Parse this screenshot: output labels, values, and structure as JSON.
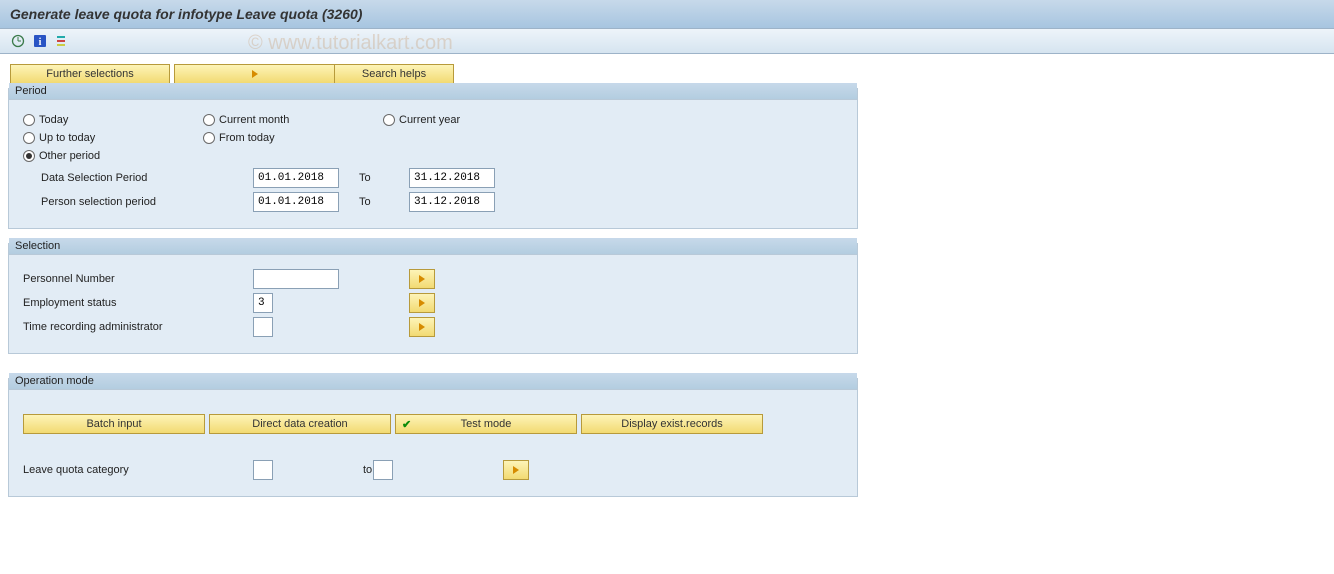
{
  "header": {
    "title": "Generate leave quota for infotype Leave quota (3260)"
  },
  "watermark": "© www.tutorialkart.com",
  "topButtons": {
    "furtherSelections": "Further selections",
    "searchHelps": "Search helps"
  },
  "periodBox": {
    "legend": "Period",
    "radios": {
      "today": "Today",
      "currentMonth": "Current month",
      "currentYear": "Current year",
      "upToToday": "Up to today",
      "fromToday": "From today",
      "otherPeriod": "Other period"
    },
    "dataSelectionLabel": "Data Selection Period",
    "personSelectionLabel": "Person selection period",
    "toLabel": "To",
    "dataFrom": "01.01.2018",
    "dataTo": "31.12.2018",
    "personFrom": "01.01.2018",
    "personTo": "31.12.2018"
  },
  "selectionBox": {
    "legend": "Selection",
    "personnelNumberLabel": "Personnel Number",
    "personnelNumberValue": "",
    "employmentStatusLabel": "Employment status",
    "employmentStatusValue": "3",
    "timeRecordingLabel": "Time recording administrator",
    "timeRecordingValue": ""
  },
  "operationBox": {
    "legend": "Operation mode",
    "batchInput": "Batch input",
    "directData": "Direct data creation",
    "testMode": "Test mode",
    "displayExist": "Display exist.records",
    "leaveQuotaLabel": "Leave quota category",
    "toLabel": "to",
    "leaveQuotaFrom": "",
    "leaveQuotaTo": ""
  }
}
